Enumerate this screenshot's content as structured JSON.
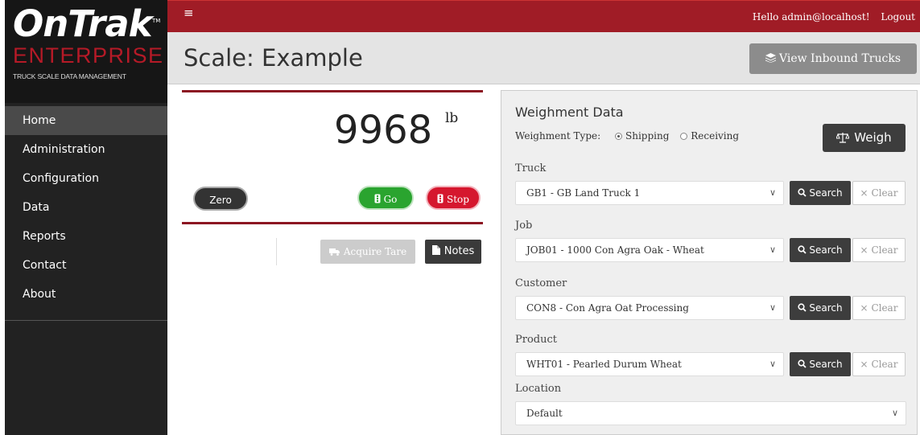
{
  "brand": {
    "logo_top": "OnTrak",
    "logo_tm": "TM",
    "logo_middle": "ENTERPRISE",
    "logo_sub": "TRUCK SCALE DATA MANAGEMENT"
  },
  "sidebar": {
    "items": [
      {
        "label": "Home",
        "active": true
      },
      {
        "label": "Administration"
      },
      {
        "label": "Configuration"
      },
      {
        "label": "Data"
      },
      {
        "label": "Reports"
      },
      {
        "label": "Contact"
      },
      {
        "label": "About"
      }
    ]
  },
  "topbar": {
    "menu_icon": "≡",
    "greeting": "Hello admin@localhost!",
    "logout": "Logout"
  },
  "header": {
    "title": "Scale: Example",
    "inbound_button": "View Inbound Trucks"
  },
  "scale": {
    "weight": "9968",
    "unit": "lb",
    "zero_label": "Zero",
    "go_label": "Go",
    "stop_label": "Stop",
    "tare_label": "Acquire Tare",
    "notes_label": "Notes"
  },
  "weighment": {
    "title": "Weighment Data",
    "type_label": "Weighment Type:",
    "options": [
      "Shipping",
      "Receiving"
    ],
    "selected_option": "Shipping",
    "weigh_button": "Weigh",
    "search_label": "Search",
    "clear_label": "Clear",
    "fields": {
      "truck": {
        "label": "Truck",
        "value": "GB1 - GB Land Truck 1"
      },
      "job": {
        "label": "Job",
        "value": "JOB01 - 1000 Con Agra Oak - Wheat"
      },
      "customer": {
        "label": "Customer",
        "value": "CON8 - Con Agra Oat Processing"
      },
      "product": {
        "label": "Product",
        "value": "WHT01 - Pearled Durum Wheat"
      },
      "location": {
        "label": "Location",
        "value": "Default"
      }
    }
  },
  "colors": {
    "brand_red": "#a01c26",
    "sidebar_bg": "#222222",
    "go_green": "#2aa42f",
    "stop_red": "#d5172e",
    "dark_button": "#3d3d3d"
  }
}
